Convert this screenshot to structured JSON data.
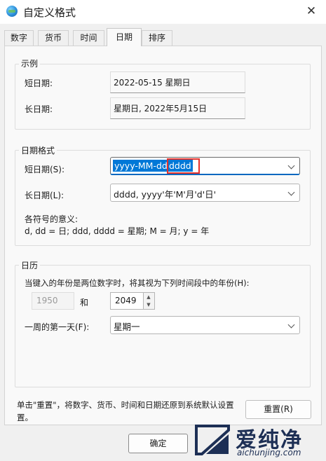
{
  "window": {
    "title": "自定义格式",
    "close_glyph": "✕"
  },
  "tabs": [
    {
      "label": "数字",
      "active": false
    },
    {
      "label": "货币",
      "active": false
    },
    {
      "label": "时间",
      "active": false
    },
    {
      "label": "日期",
      "active": true
    },
    {
      "label": "排序",
      "active": false
    }
  ],
  "sample": {
    "legend": "示例",
    "short_label": "短日期:",
    "short_value": "2022-05-15 星期日",
    "long_label": "长日期:",
    "long_value": "星期日, 2022年5月15日"
  },
  "formats": {
    "legend": "日期格式",
    "short_label": "短日期(S):",
    "short_value": "yyyy-MM-dd dddd",
    "short_selected_part": "yyyy-MM-dd",
    "short_highlight_part": "dddd",
    "long_label": "长日期(L):",
    "long_value": "dddd, yyyy'年'M'月'd'日'",
    "meaning_title": "各符号的意义:",
    "meaning_text": "d, dd = 日;  ddd, dddd = 星期;  M = 月;  y = 年"
  },
  "calendar": {
    "legend": "日历",
    "two_digit_text": "当键入的年份是两位数字时，将其视为下列时间段中的年份(H):",
    "from_year": "1950",
    "and_label": "和",
    "to_year": "2049",
    "first_day_label": "一周的第一天(F):",
    "first_day_value": "星期一"
  },
  "reset": {
    "text_line1": "单击\"重置\"，将数字、货币、时间和日期还原到系统默认设置",
    "text_line2": "置。",
    "button": "重置(R)"
  },
  "footer": {
    "ok_button": "确定"
  },
  "watermark": {
    "brand": "爱纯净",
    "url": "aichunjing.com"
  },
  "colors": {
    "accent": "#0078d7",
    "highlight_box": "#e5312a",
    "watermark": "#1d2f55"
  }
}
